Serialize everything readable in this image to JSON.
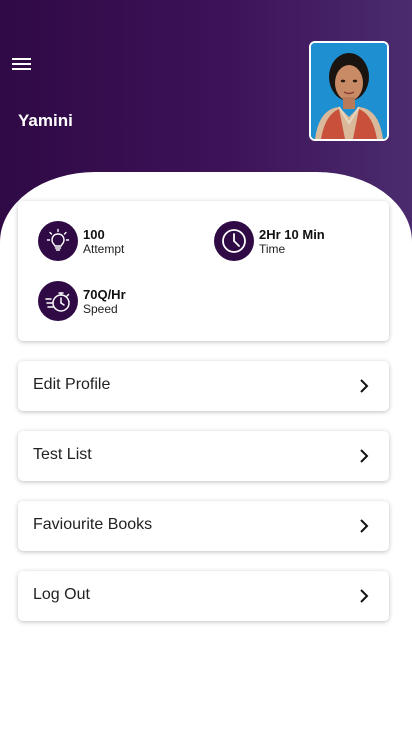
{
  "header": {
    "user_name": "Yamini",
    "menu_icon": "hamburger-menu-icon",
    "avatar": "profile-photo",
    "gradient_colors": [
      "#2f0a45",
      "#4b2b6e"
    ]
  },
  "stats": {
    "attempt": {
      "value": "100",
      "label": "Attempt",
      "icon": "lightbulb-icon"
    },
    "time": {
      "value": "2Hr 10 Min",
      "label": "Time",
      "icon": "clock-icon"
    },
    "speed": {
      "value": "70Q/Hr",
      "label": "Speed",
      "icon": "stopwatch-speed-icon"
    }
  },
  "menu": {
    "items": [
      {
        "label": "Edit Profile"
      },
      {
        "label": "Test List"
      },
      {
        "label": "Faviourite Books"
      },
      {
        "label": "Log Out"
      }
    ]
  },
  "colors": {
    "accent": "#2f0a45",
    "card_background": "#ffffff"
  }
}
